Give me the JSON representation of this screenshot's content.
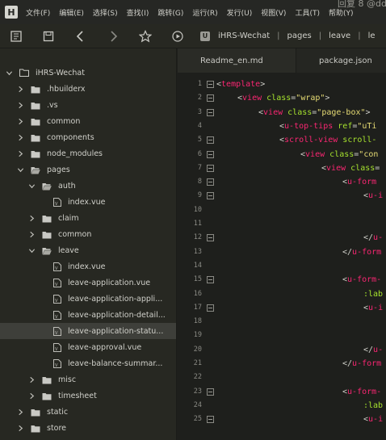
{
  "menubar": {
    "logo": "H",
    "items": [
      "文件(F)",
      "编辑(E)",
      "选择(S)",
      "查找(I)",
      "跳转(G)",
      "运行(R)",
      "发行(U)",
      "视图(V)",
      "工具(T)",
      "帮助(Y)"
    ],
    "hint": "回复 8  @dd..."
  },
  "breadcrumb": {
    "icon_letter": "U",
    "items": [
      "iHRS-Wechat",
      "pages",
      "leave",
      "le"
    ]
  },
  "sidebar": {
    "project": "iHRS-Wechat",
    "rows": [
      {
        "label": "iHRS-Wechat",
        "type": "project",
        "level": 0,
        "expanded": true
      },
      {
        "label": ".hbuilderx",
        "type": "folder",
        "level": 1,
        "expanded": false
      },
      {
        "label": ".vs",
        "type": "folder",
        "level": 1,
        "expanded": false
      },
      {
        "label": "common",
        "type": "folder",
        "level": 1,
        "expanded": false
      },
      {
        "label": "components",
        "type": "folder",
        "level": 1,
        "expanded": false
      },
      {
        "label": "node_modules",
        "type": "folder",
        "level": 1,
        "expanded": false
      },
      {
        "label": "pages",
        "type": "folder",
        "level": 1,
        "expanded": true
      },
      {
        "label": "auth",
        "type": "folder",
        "level": 2,
        "expanded": true
      },
      {
        "label": "index.vue",
        "type": "file",
        "level": 3
      },
      {
        "label": "claim",
        "type": "folder",
        "level": 2,
        "expanded": false
      },
      {
        "label": "common",
        "type": "folder",
        "level": 2,
        "expanded": false
      },
      {
        "label": "leave",
        "type": "folder",
        "level": 2,
        "expanded": true
      },
      {
        "label": "index.vue",
        "type": "file",
        "level": 3
      },
      {
        "label": "leave-application.vue",
        "type": "file",
        "level": 3
      },
      {
        "label": "leave-application-appli...",
        "type": "file",
        "level": 3
      },
      {
        "label": "leave-application-detail...",
        "type": "file",
        "level": 3
      },
      {
        "label": "leave-application-statu...",
        "type": "file",
        "level": 3,
        "selected": true
      },
      {
        "label": "leave-approval.vue",
        "type": "file",
        "level": 3
      },
      {
        "label": "leave-balance-summar...",
        "type": "file",
        "level": 3
      },
      {
        "label": "misc",
        "type": "folder",
        "level": 2,
        "expanded": false
      },
      {
        "label": "timesheet",
        "type": "folder",
        "level": 2,
        "expanded": false
      },
      {
        "label": "static",
        "type": "folder",
        "level": 1,
        "expanded": false
      },
      {
        "label": "store",
        "type": "folder",
        "level": 1,
        "expanded": false
      }
    ]
  },
  "tabs": [
    "Readme_en.md",
    "package.json"
  ],
  "editor": {
    "lines": [
      {
        "n": "1",
        "fold": true,
        "indent": 0,
        "parts": [
          [
            "p",
            "<"
          ],
          [
            "t",
            "template"
          ],
          [
            "p",
            ">"
          ]
        ]
      },
      {
        "n": "2",
        "fold": true,
        "indent": 1,
        "parts": [
          [
            "p",
            "<"
          ],
          [
            "t",
            "view"
          ],
          [
            "p",
            " "
          ],
          [
            "a",
            "class"
          ],
          [
            "p",
            "="
          ],
          [
            "s",
            "\"wrap\""
          ],
          [
            "p",
            ">"
          ]
        ]
      },
      {
        "n": "3",
        "fold": true,
        "indent": 2,
        "parts": [
          [
            "p",
            "<"
          ],
          [
            "t",
            "view"
          ],
          [
            "p",
            " "
          ],
          [
            "a",
            "class"
          ],
          [
            "p",
            "="
          ],
          [
            "s",
            "\"page-box\""
          ],
          [
            "p",
            ">"
          ]
        ]
      },
      {
        "n": "4",
        "fold": false,
        "indent": 3,
        "parts": [
          [
            "p",
            "<"
          ],
          [
            "t",
            "u-top-tips"
          ],
          [
            "p",
            " "
          ],
          [
            "a",
            "ref"
          ],
          [
            "p",
            "="
          ],
          [
            "s",
            "\"uTi"
          ]
        ]
      },
      {
        "n": "5",
        "fold": true,
        "indent": 3,
        "parts": [
          [
            "p",
            "<"
          ],
          [
            "t",
            "scroll-view"
          ],
          [
            "p",
            " "
          ],
          [
            "a",
            "scroll-"
          ]
        ]
      },
      {
        "n": "6",
        "fold": true,
        "indent": 4,
        "parts": [
          [
            "p",
            "<"
          ],
          [
            "t",
            "view"
          ],
          [
            "p",
            " "
          ],
          [
            "a",
            "class"
          ],
          [
            "p",
            "="
          ],
          [
            "s",
            "\"con"
          ]
        ]
      },
      {
        "n": "7",
        "fold": true,
        "indent": 5,
        "parts": [
          [
            "p",
            "<"
          ],
          [
            "t",
            "view"
          ],
          [
            "p",
            " "
          ],
          [
            "a",
            "class"
          ],
          [
            "p",
            "="
          ]
        ]
      },
      {
        "n": "8",
        "fold": true,
        "indent": 6,
        "parts": [
          [
            "p",
            "<"
          ],
          [
            "t",
            "u-form"
          ]
        ]
      },
      {
        "n": "9",
        "fold": true,
        "indent": 7,
        "parts": [
          [
            "p",
            "<"
          ],
          [
            "t",
            "u-i"
          ]
        ]
      },
      {
        "n": "10",
        "fold": false,
        "indent": 0,
        "parts": []
      },
      {
        "n": "11",
        "fold": false,
        "indent": 0,
        "parts": []
      },
      {
        "n": "12",
        "fold": true,
        "indent": 7,
        "parts": [
          [
            "p",
            "</"
          ],
          [
            "t",
            "u-"
          ]
        ]
      },
      {
        "n": "13",
        "fold": false,
        "indent": 6,
        "parts": [
          [
            "p",
            "</"
          ],
          [
            "t",
            "u-form"
          ]
        ]
      },
      {
        "n": "14",
        "fold": false,
        "indent": 0,
        "parts": []
      },
      {
        "n": "15",
        "fold": true,
        "indent": 6,
        "parts": [
          [
            "p",
            "<"
          ],
          [
            "t",
            "u-form-"
          ]
        ]
      },
      {
        "n": "16",
        "fold": false,
        "indent": 7,
        "parts": [
          [
            "a",
            ":lab"
          ]
        ]
      },
      {
        "n": "17",
        "fold": true,
        "indent": 7,
        "parts": [
          [
            "p",
            "<"
          ],
          [
            "t",
            "u-i"
          ]
        ]
      },
      {
        "n": "18",
        "fold": false,
        "indent": 0,
        "parts": []
      },
      {
        "n": "19",
        "fold": false,
        "indent": 0,
        "parts": []
      },
      {
        "n": "20",
        "fold": false,
        "indent": 7,
        "parts": [
          [
            "p",
            "</"
          ],
          [
            "t",
            "u-"
          ]
        ]
      },
      {
        "n": "21",
        "fold": false,
        "indent": 6,
        "parts": [
          [
            "p",
            "</"
          ],
          [
            "t",
            "u-form"
          ]
        ]
      },
      {
        "n": "22",
        "fold": false,
        "indent": 0,
        "parts": []
      },
      {
        "n": "23",
        "fold": true,
        "indent": 6,
        "parts": [
          [
            "p",
            "<"
          ],
          [
            "t",
            "u-form-"
          ]
        ]
      },
      {
        "n": "24",
        "fold": false,
        "indent": 7,
        "parts": [
          [
            "a",
            ":lab"
          ]
        ]
      },
      {
        "n": "25",
        "fold": true,
        "indent": 7,
        "parts": [
          [
            "p",
            "<"
          ],
          [
            "t",
            "u-i"
          ]
        ]
      }
    ]
  },
  "colors": {
    "tag": "#f92672",
    "attribute": "#a6e22e",
    "string": "#e6db74",
    "background": "#1e1f1c",
    "sidebar": "#272822"
  }
}
